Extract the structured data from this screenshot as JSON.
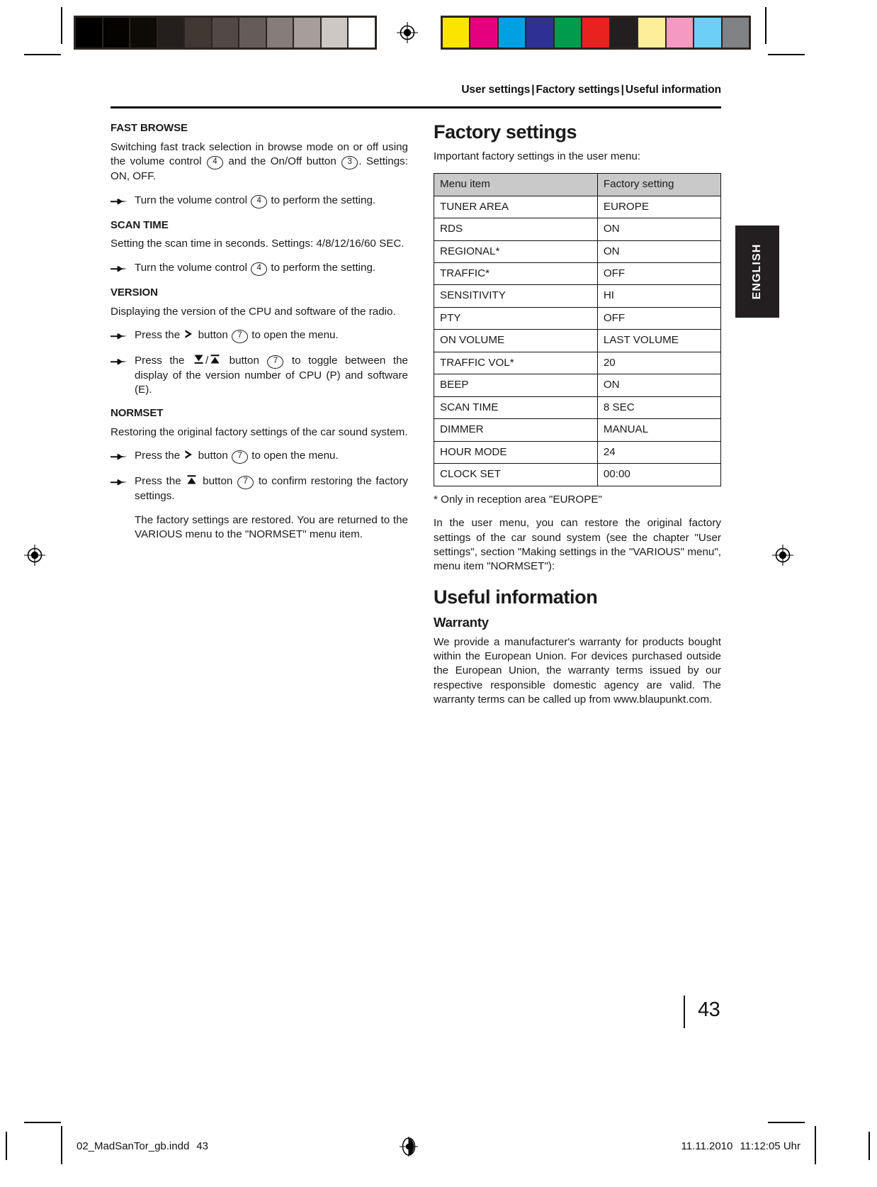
{
  "calibration": {
    "gray_swatches": [
      "#000000",
      "#050300",
      "#0e0a05",
      "#241f1c",
      "#3f3833",
      "#514945",
      "#655c59",
      "#867c79",
      "#a79d9a",
      "#cdc8c4",
      "#ffffff"
    ],
    "color_swatches": [
      "#fbe500",
      "#e5007d",
      "#00a0e3",
      "#2e3192",
      "#009b4c",
      "#e8231f",
      "#231f20",
      "#fbef9a",
      "#f49ac1",
      "#6dcff6",
      "#808285"
    ],
    "registration_icon": "registration-target-icon"
  },
  "running_head": {
    "part1": "User settings",
    "part2": "Factory settings",
    "part3": "Useful information",
    "separator": "|"
  },
  "language_tab": {
    "label": "ENGLISH"
  },
  "page_number": "43",
  "footer": {
    "file_name": "02_MadSanTor_gb.indd",
    "file_page": "43",
    "date": "11.11.2010",
    "time": "11:12:05 Uhr",
    "registration_icon": "registration-target-icon"
  },
  "left_column": {
    "sections": [
      {
        "heading": "FAST BROWSE",
        "intro_a": "Switching fast track selection in browse mode on or off using the volume control ",
        "intro_ref1": "4",
        "intro_b": " and the On/Off button ",
        "intro_ref2": "3",
        "intro_c": ". Settings: ON, OFF.",
        "step_a": "Turn the volume control ",
        "step_ref": "4",
        "step_b": " to perform the setting."
      },
      {
        "heading": "SCAN TIME",
        "intro": "Setting the scan time in seconds. Settings: 4/8/12/16/60 SEC.",
        "step_a": "Turn the volume control ",
        "step_ref": "4",
        "step_b": " to perform the setting."
      },
      {
        "heading": "VERSION",
        "intro": "Displaying the version of the CPU and software of the radio.",
        "step1_a": "Press the ",
        "step1_icon": "arrow-right-icon",
        "step1_b": " button ",
        "step1_ref": "7",
        "step1_c": " to open the menu.",
        "step2_a": "Press the ",
        "step2_icon_down": "arrow-down-bar-icon",
        "step2_slash": "/",
        "step2_icon_up": "arrow-up-bar-icon",
        "step2_b": " button ",
        "step2_ref": "7",
        "step2_c": " to toggle between the display of the version number of CPU (P) and software (E)."
      },
      {
        "heading": "NORMSET",
        "intro": "Restoring the original factory settings of the car sound system.",
        "step1_a": "Press the ",
        "step1_icon": "arrow-right-icon",
        "step1_b": " button ",
        "step1_ref": "7",
        "step1_c": " to open the menu.",
        "step2_a": "Press the ",
        "step2_icon": "arrow-up-bar-icon",
        "step2_b": " button ",
        "step2_ref": "7",
        "step2_c": " to confirm restoring the factory settings.",
        "note": "The factory settings are restored. You are returned to the VARIOUS menu to the \"NORMSET\" menu item."
      }
    ]
  },
  "right_column": {
    "factory_settings": {
      "title": "Factory settings",
      "intro": "Important factory settings in the user menu:",
      "table": {
        "headers": [
          "Menu item",
          "Factory setting"
        ],
        "rows": [
          [
            "TUNER AREA",
            "EUROPE"
          ],
          [
            "RDS",
            "ON"
          ],
          [
            "REGIONAL*",
            "ON"
          ],
          [
            "TRAFFIC*",
            "OFF"
          ],
          [
            "SENSITIVITY",
            "HI"
          ],
          [
            "PTY",
            "OFF"
          ],
          [
            "ON VOLUME",
            "LAST VOLUME"
          ],
          [
            "TRAFFIC VOL*",
            "20"
          ],
          [
            "BEEP",
            "ON"
          ],
          [
            "SCAN TIME",
            "8 SEC"
          ],
          [
            "DIMMER",
            "MANUAL"
          ],
          [
            "HOUR MODE",
            "24"
          ],
          [
            "CLOCK SET",
            "00:00"
          ]
        ]
      },
      "footnote": "* Only in reception area \"EUROPE\"",
      "paragraph": "In the user menu, you can restore the original factory settings of the car sound system (see the chapter \"User settings\", section \"Making settings in the \"VARIOUS\" menu\", menu item \"NORMSET\"):"
    },
    "useful_information": {
      "title": "Useful information",
      "warranty_heading": "Warranty",
      "warranty_text": "We provide a manufacturer's warranty for products bought within the European Union. For devices purchased outside the European Union, the warranty terms issued by our respective responsible domestic agency are valid. The warranty terms can be called up from www.blaupunkt.com."
    }
  }
}
